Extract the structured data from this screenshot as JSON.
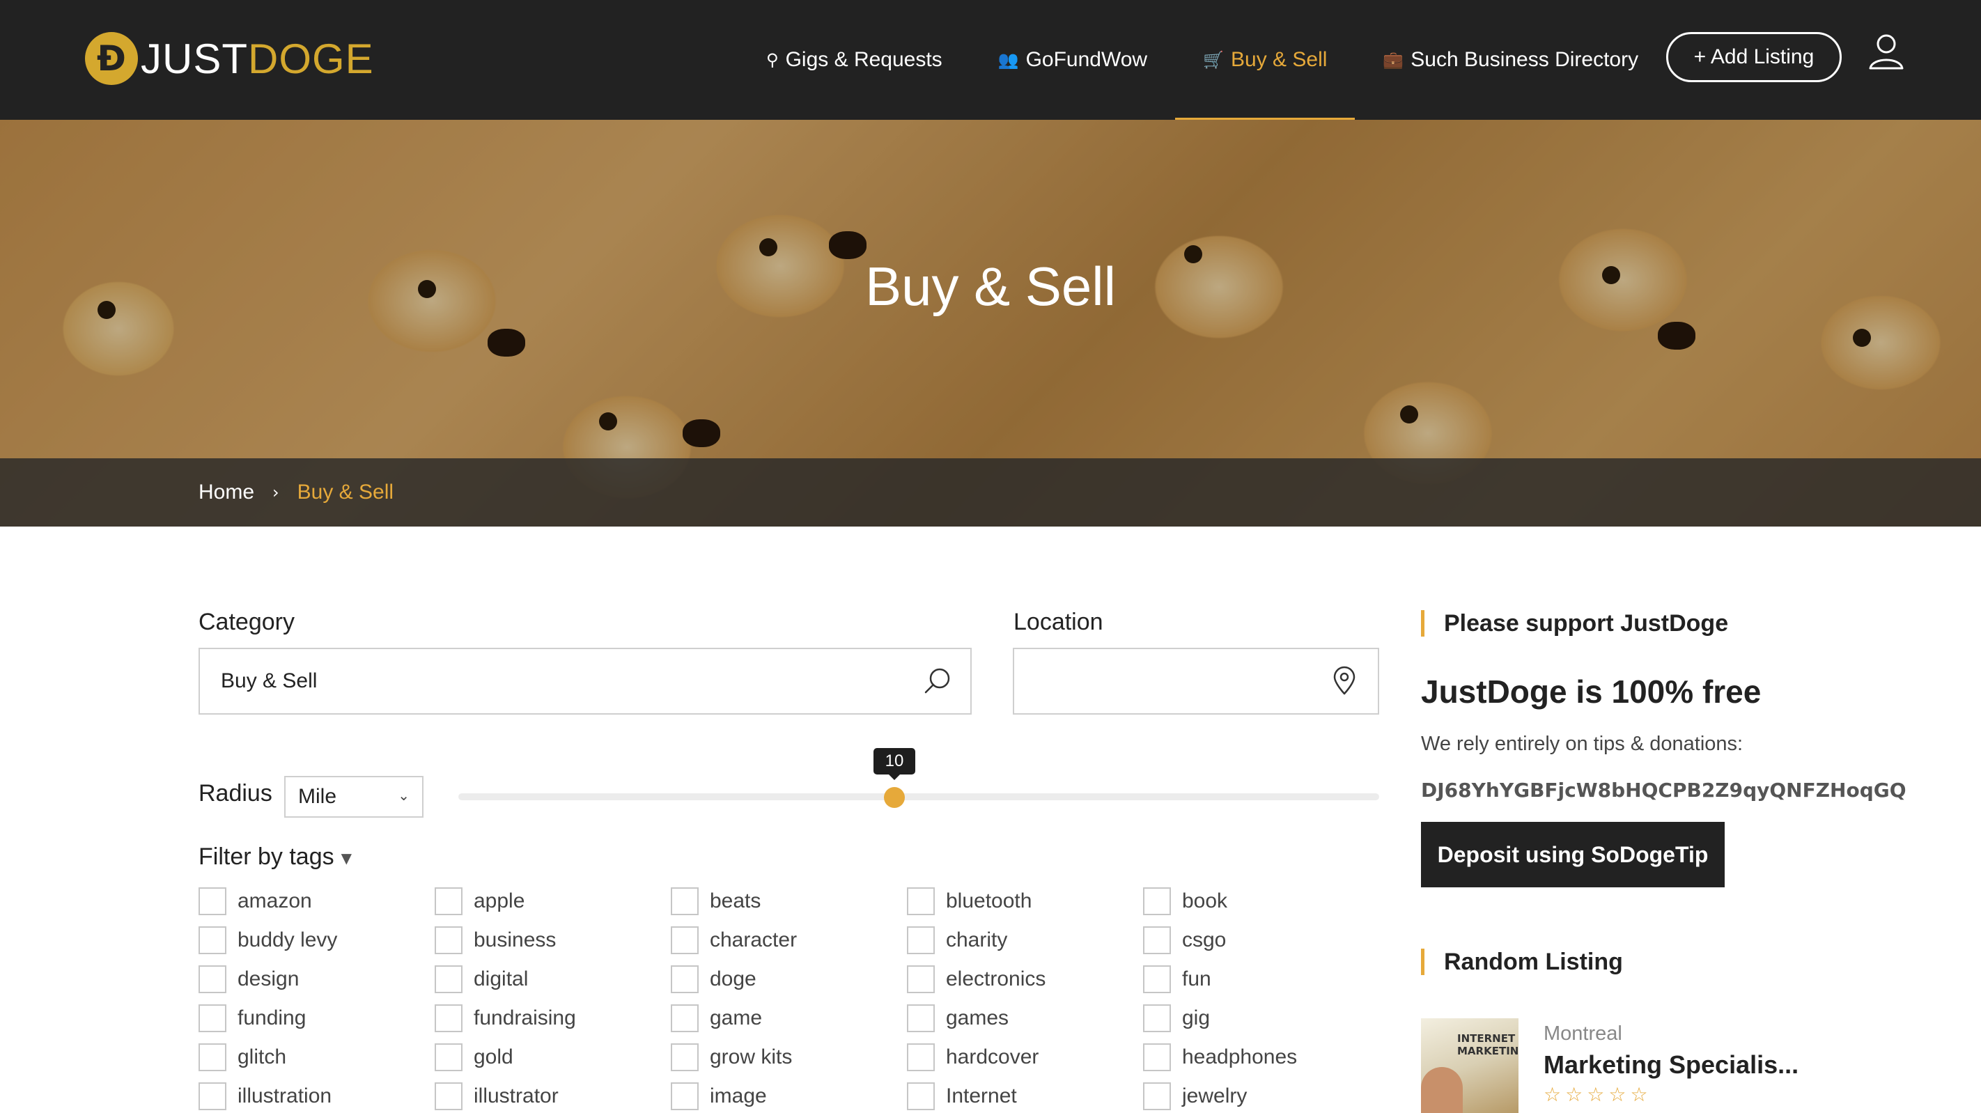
{
  "header": {
    "logo_mark": "Đ",
    "logo_part1": "JUST",
    "logo_part2": "DOGE",
    "nav": [
      {
        "label": "Gigs & Requests",
        "icon": "map-pin-icon",
        "glyph": "⚲"
      },
      {
        "label": "GoFundWow",
        "icon": "users-icon",
        "glyph": "👥"
      },
      {
        "label": "Buy & Sell",
        "icon": "cart-icon",
        "glyph": "🛒",
        "active": true
      },
      {
        "label": "Such Business Directory",
        "icon": "briefcase-icon",
        "glyph": "💼"
      }
    ],
    "add_listing": "+ Add Listing",
    "accent": "#e6a93a"
  },
  "hero": {
    "title": "Buy & Sell"
  },
  "breadcrumb": {
    "home": "Home",
    "separator": "›",
    "current": "Buy & Sell"
  },
  "search": {
    "category_label": "Category",
    "category_value": "Buy & Sell",
    "location_label": "Location",
    "location_value": "",
    "radius_label": "Radius",
    "radius_unit": "Mile",
    "radius_value": "10",
    "radius_fraction": 0.333,
    "filter_label": "Filter by tags"
  },
  "tags": [
    [
      "amazon",
      "apple",
      "beats",
      "bluetooth",
      "book"
    ],
    [
      "buddy levy",
      "business",
      "character",
      "charity",
      "csgo"
    ],
    [
      "design",
      "digital",
      "doge",
      "electronics",
      "fun"
    ],
    [
      "funding",
      "fundraising",
      "game",
      "games",
      "gig"
    ],
    [
      "glitch",
      "gold",
      "grow kits",
      "hardcover",
      "headphones"
    ],
    [
      "illustration",
      "illustrator",
      "image",
      "Internet",
      "jewelry"
    ]
  ],
  "sidebar": {
    "support_heading": "Please support JustDoge",
    "free_title": "JustDoge is 100% free",
    "rely_text": "We rely entirely on tips & donations:",
    "address": "DJ68YhYGBFjcW8bHQCPB2Z9qyQNFZHoqGQ",
    "deposit_label": "Deposit using SoDogeTip",
    "random_heading": "Random Listing",
    "thumb_text": "INTERNET MARKETING",
    "listing_city": "Montreal",
    "listing_title": "Marketing Specialis...",
    "listing_rating": 0,
    "listing_rating_max": 5
  }
}
